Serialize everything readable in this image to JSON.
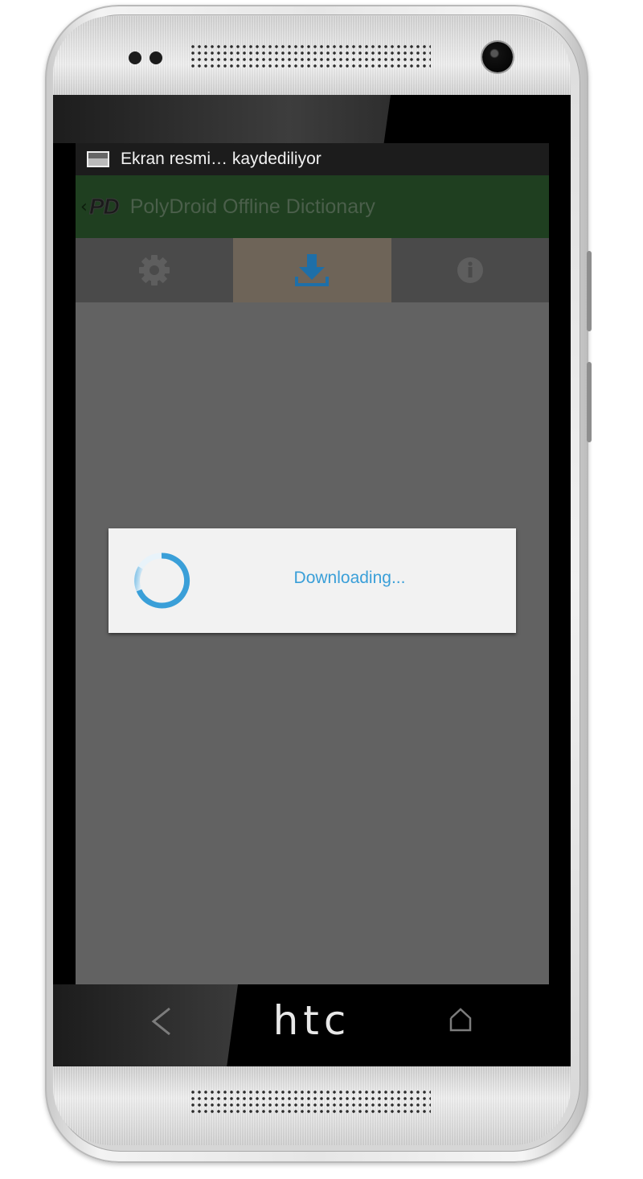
{
  "device": {
    "brand": "htc"
  },
  "status_bar": {
    "notification_text": "Ekran resmi… kaydediliyor",
    "notification_icon": "screenshot-icon"
  },
  "action_bar": {
    "logo": "PD",
    "title": "PolyDroid Offline Dictionary",
    "color": "#1f3f20"
  },
  "tabs": [
    {
      "icon": "gear-icon",
      "selected": false
    },
    {
      "icon": "download-icon",
      "selected": true
    },
    {
      "icon": "info-icon",
      "selected": false
    }
  ],
  "dialog": {
    "message": "Downloading...",
    "accent_color": "#3a9fd8"
  },
  "nav_keys": [
    {
      "icon": "back-icon"
    },
    {
      "icon": "home-icon"
    }
  ]
}
